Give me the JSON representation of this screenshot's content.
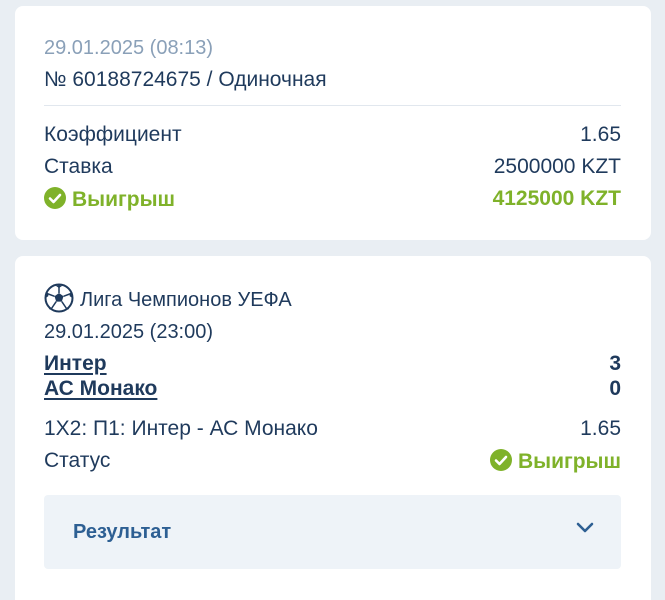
{
  "bet": {
    "datetime": "29.01.2025 (08:13)",
    "number_line": "№ 60188724675 / Одиночная",
    "odds_label": "Коэффициент",
    "odds_value": "1.65",
    "stake_label": "Ставка",
    "stake_value": "2500000 KZT",
    "result_label": "Выигрыш",
    "result_value": "4125000 KZT"
  },
  "event": {
    "league": "Лига Чемпионов УЕФА",
    "datetime": "29.01.2025 (23:00)",
    "team1": "Интер",
    "team1_score": "3",
    "team2": "АС Монако",
    "team2_score": "0",
    "market": "1X2: П1: Интер - АС Монако",
    "market_odds": "1.65",
    "status_label": "Статус",
    "status_value": "Выигрыш",
    "result_section_label": "Результат"
  },
  "colors": {
    "win_green": "#7fb22a",
    "text_dark": "#1f3a5c",
    "muted": "#8aa0b8",
    "link_blue": "#2d5f93"
  }
}
